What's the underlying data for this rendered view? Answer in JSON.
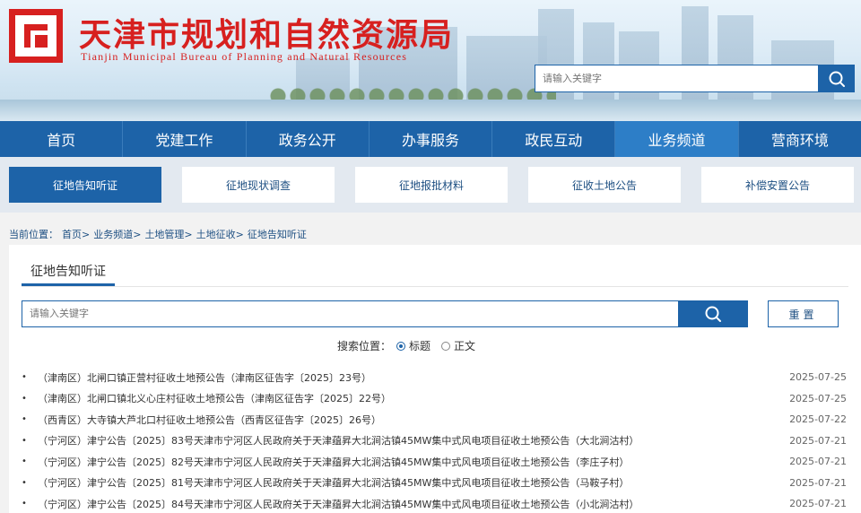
{
  "site": {
    "title": "天津市规划和自然资源局",
    "subtitle": "Tianjin Municipal Bureau of Planning and Natural Resources"
  },
  "top_search": {
    "placeholder": "请输入关键字",
    "icon": "search-icon"
  },
  "nav": {
    "items": [
      {
        "label": "首页"
      },
      {
        "label": "党建工作"
      },
      {
        "label": "政务公开"
      },
      {
        "label": "办事服务"
      },
      {
        "label": "政民互动"
      },
      {
        "label": "业务频道",
        "active": true
      },
      {
        "label": "营商环境"
      }
    ]
  },
  "subtabs": {
    "items": [
      {
        "label": "征地告知听证",
        "active": true
      },
      {
        "label": "征地现状调查"
      },
      {
        "label": "征地报批材料"
      },
      {
        "label": "征收土地公告"
      },
      {
        "label": "补偿安置公告"
      }
    ]
  },
  "breadcrumb": {
    "prefix": "当前位置：",
    "items": [
      "首页>",
      "业务频道>",
      "土地管理>",
      "土地征收>",
      "征地告知听证"
    ]
  },
  "panel": {
    "tab_label": "征地告知听证",
    "search_placeholder": "请输入关键字",
    "reset_label": "重置",
    "search_scope_label": "搜索位置：",
    "scope_options": [
      {
        "label": "标题",
        "selected": true
      },
      {
        "label": "正文",
        "selected": false
      }
    ]
  },
  "list": [
    {
      "title": "（津南区）北闸口镇正营村征收土地预公告（津南区征告字〔2025〕23号）",
      "date": "2025-07-25"
    },
    {
      "title": "（津南区）北闸口镇北义心庄村征收土地预公告（津南区征告字〔2025〕22号）",
      "date": "2025-07-25"
    },
    {
      "title": "（西青区）大寺镇大芦北口村征收土地预公告（西青区征告字〔2025〕26号）",
      "date": "2025-07-22"
    },
    {
      "title": "（宁河区）津宁公告〔2025〕83号天津市宁河区人民政府关于天津蕴昇大北涧沽镇45MW集中式风电项目征收土地预公告（大北涧沽村）",
      "date": "2025-07-21"
    },
    {
      "title": "（宁河区）津宁公告〔2025〕82号天津市宁河区人民政府关于天津蕴昇大北涧沽镇45MW集中式风电项目征收土地预公告（李庄子村）",
      "date": "2025-07-21"
    },
    {
      "title": "（宁河区）津宁公告〔2025〕81号天津市宁河区人民政府关于天津蕴昇大北涧沽镇45MW集中式风电项目征收土地预公告（马鞍子村）",
      "date": "2025-07-21"
    },
    {
      "title": "（宁河区）津宁公告〔2025〕84号天津市宁河区人民政府关于天津蕴昇大北涧沽镇45MW集中式风电项目征收土地预公告（小北涧沽村）",
      "date": "2025-07-21"
    }
  ]
}
